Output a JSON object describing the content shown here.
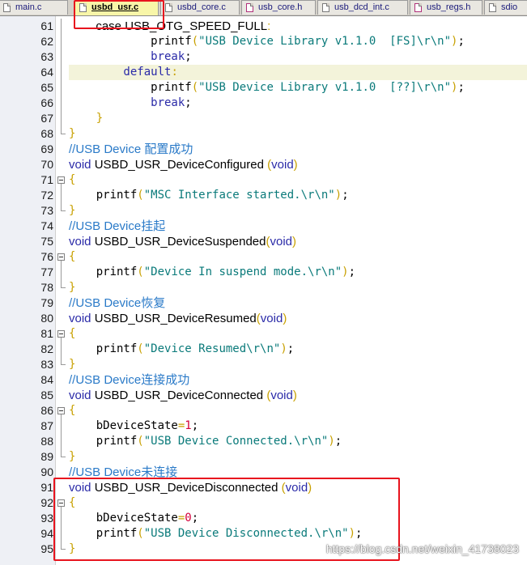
{
  "tabs": [
    {
      "label": "main.c",
      "icon": "c-file-icon",
      "active": false
    },
    {
      "label": "usbd_usr.c",
      "icon": "c-file-icon",
      "active": true
    },
    {
      "label": "usbd_core.c",
      "icon": "c-file-icon",
      "active": false
    },
    {
      "label": "usb_core.h",
      "icon": "h-file-icon",
      "active": false
    },
    {
      "label": "usb_dcd_int.c",
      "icon": "c-file-icon",
      "active": false
    },
    {
      "label": "usb_regs.h",
      "icon": "h-file-icon",
      "active": false
    },
    {
      "label": "sdio",
      "icon": "c-file-icon",
      "active": false
    }
  ],
  "editor": {
    "current_line": 64,
    "lines": [
      {
        "n": 61,
        "fold": "line",
        "tokens": [
          [
            "t",
            "        case USB_OTG_SPEED_FULL"
          ],
          [
            "o",
            ":"
          ]
        ],
        "prop": true
      },
      {
        "n": 62,
        "fold": "line",
        "tokens": [
          [
            "t",
            "            printf"
          ],
          [
            "b",
            "("
          ],
          [
            "s",
            "\"USB Device Library v1.1.0  [FS]\\r\\n\""
          ],
          [
            "b",
            ")"
          ],
          [
            "t",
            ";"
          ]
        ]
      },
      {
        "n": 63,
        "fold": "line",
        "tokens": [
          [
            "k",
            "            break"
          ],
          [
            "t",
            ";"
          ]
        ]
      },
      {
        "n": 64,
        "fold": "line",
        "tokens": [
          [
            "k",
            "        default"
          ],
          [
            "o",
            ":"
          ]
        ]
      },
      {
        "n": 65,
        "fold": "line",
        "tokens": [
          [
            "t",
            "            printf"
          ],
          [
            "b",
            "("
          ],
          [
            "s",
            "\"USB Device Library v1.1.0  [??]\\r\\n\""
          ],
          [
            "b",
            ")"
          ],
          [
            "t",
            ";"
          ]
        ]
      },
      {
        "n": 66,
        "fold": "line",
        "tokens": [
          [
            "k",
            "            break"
          ],
          [
            "t",
            ";"
          ]
        ]
      },
      {
        "n": 67,
        "fold": "line",
        "tokens": [
          [
            "b",
            "    }"
          ]
        ]
      },
      {
        "n": 68,
        "fold": "end",
        "tokens": [
          [
            "b",
            "}"
          ]
        ]
      },
      {
        "n": 69,
        "fold": "none",
        "tokens": [
          [
            "c",
            "//USB Device 配置成功"
          ]
        ],
        "prop": true
      },
      {
        "n": 70,
        "fold": "none",
        "tokens": [
          [
            "k",
            "void"
          ],
          [
            "t",
            " USBD_USR_DeviceConfigured "
          ],
          [
            "b",
            "("
          ],
          [
            "k",
            "void"
          ],
          [
            "b",
            ")"
          ]
        ],
        "prop": true
      },
      {
        "n": 71,
        "fold": "box",
        "tokens": [
          [
            "b",
            "{"
          ]
        ]
      },
      {
        "n": 72,
        "fold": "line",
        "tokens": [
          [
            "t",
            "    printf"
          ],
          [
            "b",
            "("
          ],
          [
            "s",
            "\"MSC Interface started.\\r\\n\""
          ],
          [
            "b",
            ")"
          ],
          [
            "t",
            ";"
          ]
        ]
      },
      {
        "n": 73,
        "fold": "end",
        "tokens": [
          [
            "b",
            "}"
          ]
        ]
      },
      {
        "n": 74,
        "fold": "none",
        "tokens": [
          [
            "c",
            "//USB Device挂起"
          ]
        ],
        "prop": true
      },
      {
        "n": 75,
        "fold": "none",
        "tokens": [
          [
            "k",
            "void"
          ],
          [
            "t",
            " USBD_USR_DeviceSuspended"
          ],
          [
            "b",
            "("
          ],
          [
            "k",
            "void"
          ],
          [
            "b",
            ")"
          ]
        ],
        "prop": true
      },
      {
        "n": 76,
        "fold": "box",
        "tokens": [
          [
            "b",
            "{"
          ]
        ]
      },
      {
        "n": 77,
        "fold": "line",
        "tokens": [
          [
            "t",
            "    printf"
          ],
          [
            "b",
            "("
          ],
          [
            "s",
            "\"Device In suspend mode.\\r\\n\""
          ],
          [
            "b",
            ")"
          ],
          [
            "t",
            ";"
          ]
        ]
      },
      {
        "n": 78,
        "fold": "end",
        "tokens": [
          [
            "b",
            "}"
          ]
        ]
      },
      {
        "n": 79,
        "fold": "none",
        "tokens": [
          [
            "c",
            "//USB Device恢复"
          ]
        ],
        "prop": true
      },
      {
        "n": 80,
        "fold": "none",
        "tokens": [
          [
            "k",
            "void"
          ],
          [
            "t",
            " USBD_USR_DeviceResumed"
          ],
          [
            "b",
            "("
          ],
          [
            "k",
            "void"
          ],
          [
            "b",
            ")"
          ]
        ],
        "prop": true
      },
      {
        "n": 81,
        "fold": "box",
        "tokens": [
          [
            "b",
            "{"
          ]
        ]
      },
      {
        "n": 82,
        "fold": "line",
        "tokens": [
          [
            "t",
            "    printf"
          ],
          [
            "b",
            "("
          ],
          [
            "s",
            "\"Device Resumed\\r\\n\""
          ],
          [
            "b",
            ")"
          ],
          [
            "t",
            ";"
          ]
        ]
      },
      {
        "n": 83,
        "fold": "end",
        "tokens": [
          [
            "b",
            "}"
          ]
        ]
      },
      {
        "n": 84,
        "fold": "none",
        "tokens": [
          [
            "c",
            "//USB Device连接成功"
          ]
        ],
        "prop": true
      },
      {
        "n": 85,
        "fold": "none",
        "tokens": [
          [
            "k",
            "void"
          ],
          [
            "t",
            " USBD_USR_DeviceConnected "
          ],
          [
            "b",
            "("
          ],
          [
            "k",
            "void"
          ],
          [
            "b",
            ")"
          ]
        ],
        "prop": true
      },
      {
        "n": 86,
        "fold": "box",
        "tokens": [
          [
            "b",
            "{"
          ]
        ]
      },
      {
        "n": 87,
        "fold": "line",
        "tokens": [
          [
            "t",
            "    bDeviceState"
          ],
          [
            "o",
            "="
          ],
          [
            "n",
            "1"
          ],
          [
            "t",
            ";"
          ]
        ]
      },
      {
        "n": 88,
        "fold": "line",
        "tokens": [
          [
            "t",
            "    printf"
          ],
          [
            "b",
            "("
          ],
          [
            "s",
            "\"USB Device Connected.\\r\\n\""
          ],
          [
            "b",
            ")"
          ],
          [
            "t",
            ";"
          ]
        ]
      },
      {
        "n": 89,
        "fold": "end",
        "tokens": [
          [
            "b",
            "}"
          ]
        ]
      },
      {
        "n": 90,
        "fold": "none",
        "tokens": [
          [
            "c",
            "//USB Device未连接"
          ]
        ],
        "prop": true
      },
      {
        "n": 91,
        "fold": "none",
        "tokens": [
          [
            "k",
            "void"
          ],
          [
            "t",
            " USBD_USR_DeviceDisconnected "
          ],
          [
            "b",
            "("
          ],
          [
            "k",
            "void"
          ],
          [
            "b",
            ")"
          ]
        ],
        "prop": true
      },
      {
        "n": 92,
        "fold": "box",
        "tokens": [
          [
            "b",
            "{"
          ]
        ]
      },
      {
        "n": 93,
        "fold": "line",
        "tokens": [
          [
            "t",
            "    bDeviceState"
          ],
          [
            "o",
            "="
          ],
          [
            "n",
            "0"
          ],
          [
            "t",
            ";"
          ]
        ]
      },
      {
        "n": 94,
        "fold": "line",
        "tokens": [
          [
            "t",
            "    printf"
          ],
          [
            "b",
            "("
          ],
          [
            "s",
            "\"USB Device Disconnected.\\r\\n\""
          ],
          [
            "b",
            ")"
          ],
          [
            "t",
            ";"
          ]
        ]
      },
      {
        "n": 95,
        "fold": "end",
        "tokens": [
          [
            "b",
            "}"
          ]
        ]
      }
    ]
  },
  "watermark": "https://blog.csdn.net/weixin_41738023",
  "colors": {
    "highlight_box": "#e8141e",
    "keyword": "#2a2aa8",
    "string": "#0a7a7a",
    "comment": "#2a7ac8",
    "number": "#d4003a",
    "bracket": "#c8a000"
  }
}
